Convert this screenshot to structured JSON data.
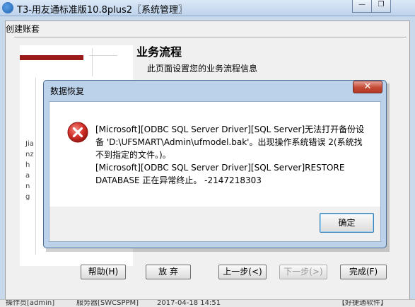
{
  "window": {
    "title": "T3-用友通标准版10.8plus2〖系统管理〗",
    "minimize_glyph": "—",
    "restore_glyph": "❐"
  },
  "wizard": {
    "title": "创建账套",
    "vertical_text": "Jianzhang",
    "section_title": "业务流程",
    "section_desc": "此页面设置您的业务流程信息",
    "buttons": {
      "help": "帮助(H)",
      "abandon": "放 弃",
      "prev": "上一步(<)",
      "next": "下一步(>)",
      "finish": "完成(F)"
    }
  },
  "status_bar": {
    "segments": [
      "操作员[admin]",
      "服务器[SWCSPPM]",
      "2017-04-18 14:51",
      "【好捷通软件】"
    ]
  },
  "dialog": {
    "title": "数据恢复",
    "close_glyph": "✕",
    "message_lines": [
      "[Microsoft][ODBC SQL Server Driver][SQL Server]无法打开备份设",
      "备 'D:\\UFSMART\\Admin\\ufmodel.bak'。出现操作系统错误 2(系统找",
      "不到指定的文件。)。",
      "[Microsoft][ODBC SQL Server Driver][SQL Server]RESTORE",
      "DATABASE 正在异常终止。 -2147218303"
    ],
    "ok_label": "确定"
  },
  "colors": {
    "accent_red": "#9b1b1b",
    "dialog_frame": "#bcd2ea",
    "error_icon": "#d2302a"
  }
}
